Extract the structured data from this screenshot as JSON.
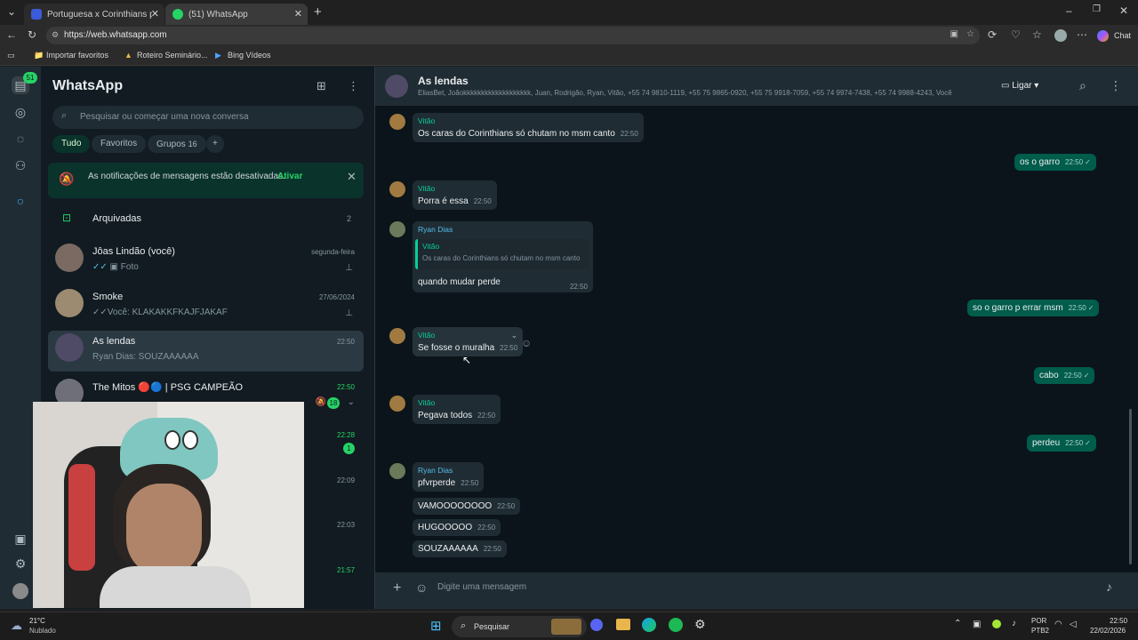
{
  "browser": {
    "tabs": [
      {
        "title": "Portuguesa x Corinthians placar ao"
      },
      {
        "title": "(51) WhatsApp"
      }
    ],
    "url": "https://web.whatsapp.com",
    "bookmarks": [
      "Importar favoritos",
      "Roteiro Seminário...",
      "Bing Vídeos"
    ],
    "copilot_label": "Chat"
  },
  "rail": {
    "badge": "51"
  },
  "sidebar": {
    "title": "WhatsApp",
    "search_placeholder": "Pesquisar ou começar uma nova conversa",
    "filters": [
      "Tudo",
      "Favoritos",
      "Grupos",
      "16"
    ],
    "notice": {
      "text": "As notificações de mensagens estão desativadas.",
      "action": "Ativar"
    },
    "archived": {
      "label": "Arquivadas",
      "count": "2"
    },
    "chats": [
      {
        "name": "Jôas Lindão (você)",
        "preview": "Foto",
        "time": "segunda-feira"
      },
      {
        "name": "Smoke",
        "preview": "Você: KLAKAKKFKAJFJAKAF",
        "time": "27/06/2024"
      },
      {
        "name": "As lendas",
        "preview": "Ryan Dias: SOUZAAAAAA",
        "time": "22:50"
      },
      {
        "name": "The Mitos 🔴🔵 | PSG CAMPEÃO",
        "preview": "",
        "time": "22:50",
        "unread": "18"
      }
    ],
    "hidden_times": [
      {
        "time": "22:28",
        "unread": "1"
      },
      {
        "time": "22:09"
      },
      {
        "time": "22:03"
      },
      {
        "time": "21:57"
      }
    ]
  },
  "chat": {
    "name": "As lendas",
    "members": "EliasBet, Joãokkkkkkkkkkkkkkkkkkk, Juan, Rodrigão, Ryan, Vitão, +55 74 9810-1119, +55 75 9865-0920, +55 75 9918-7059, +55 74 9974-7438, +55 74 9988-4243, Você",
    "call_label": "Ligar",
    "composer_placeholder": "Digite uma mensagem",
    "messages": [
      {
        "sender": "Vitão",
        "text": "Os caras do Corinthians só chutam no msm canto",
        "time": "22:50"
      },
      {
        "out": true,
        "text": "os o garro",
        "time": "22:50"
      },
      {
        "sender": "Vitão",
        "text": "Porra é essa",
        "time": "22:50"
      },
      {
        "sender": "Ryan Dias",
        "quote_sender": "Vitão",
        "quote_text": "Os caras do Corinthians só chutam no msm canto",
        "text": "quando mudar perde",
        "time": "22:50"
      },
      {
        "out": true,
        "text": "so o garro p errar msm",
        "time": "22:50"
      },
      {
        "sender": "Vitão",
        "text": "Se fosse o muralha",
        "time": "22:50"
      },
      {
        "out": true,
        "text": "cabo",
        "time": "22:50"
      },
      {
        "sender": "Vitão",
        "text": "Pegava todos",
        "time": "22:50"
      },
      {
        "out": true,
        "text": "perdeu",
        "time": "22:50"
      },
      {
        "sender": "Ryan Dias",
        "text": "pfvrperde",
        "time": "22:50"
      },
      {
        "text": "VAMOOOOOOOO",
        "time": "22:50"
      },
      {
        "text": "HUGOOOOO",
        "time": "22:50"
      },
      {
        "text": "SOUZAAAAAA",
        "time": "22:50"
      }
    ]
  },
  "taskbar": {
    "weather_temp": "21°C",
    "weather_desc": "Nublado",
    "search_label": "Pesquisar",
    "lang": "POR",
    "layout": "PTB2",
    "time": "22:50",
    "date": "22/02/2026"
  },
  "colors": {
    "accent": "#25d366",
    "outgoing": "#005c4b",
    "incoming": "#202c33",
    "vitao": "#06cf9c",
    "ryan": "#53bdeb"
  }
}
